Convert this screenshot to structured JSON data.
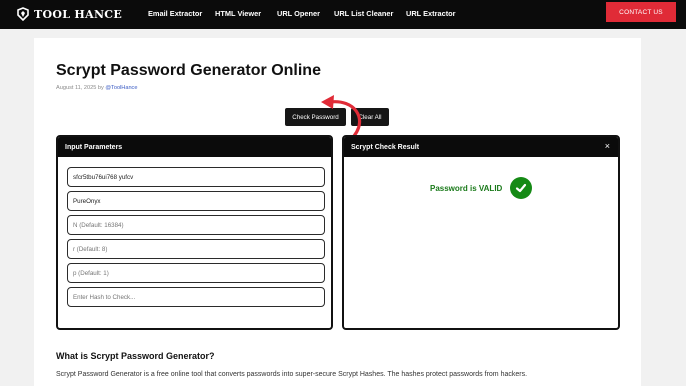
{
  "brand": {
    "name": "Tool Hance"
  },
  "nav": {
    "items": [
      "Email Extractor",
      "HTML Viewer",
      "URL Opener",
      "URL List Cleaner",
      "URL Extractor"
    ],
    "contact_label": "CONTACT US"
  },
  "page": {
    "title": "Scrypt Password Generator Online",
    "date_prefix": "August 11, 2025 by",
    "author": "@ToolHance"
  },
  "actions": {
    "check_label": "Check Password",
    "clear_label": "Clear All"
  },
  "input_panel": {
    "title": "Input Parameters",
    "fields": [
      {
        "value": "sfcr5tbu76ui768 yufcv",
        "placeholder": ""
      },
      {
        "value": "PureOnyx",
        "placeholder": ""
      },
      {
        "value": "",
        "placeholder": "N (Default: 16384)"
      },
      {
        "value": "",
        "placeholder": "r (Default: 8)"
      },
      {
        "value": "",
        "placeholder": "p (Default: 1)"
      },
      {
        "value": "",
        "placeholder": "Enter Hash to Check..."
      }
    ]
  },
  "result_panel": {
    "title": "Scrypt Check Result",
    "close_symbol": "×",
    "message": "Password is VALID"
  },
  "article": {
    "heading": "What is Scrypt Password Generator?",
    "text": "Scrypt Password Generator is a free online tool that converts passwords into super-secure Scrypt Hashes. The hashes protect passwords from hackers."
  },
  "colors": {
    "accent": "#e02b37",
    "valid": "#158a15",
    "dark": "#0b0b0b"
  },
  "icons": {
    "logo": "tool-hance-logo-icon",
    "close": "close-icon",
    "valid": "check-circle-icon",
    "pointer": "curved-arrow-icon"
  }
}
